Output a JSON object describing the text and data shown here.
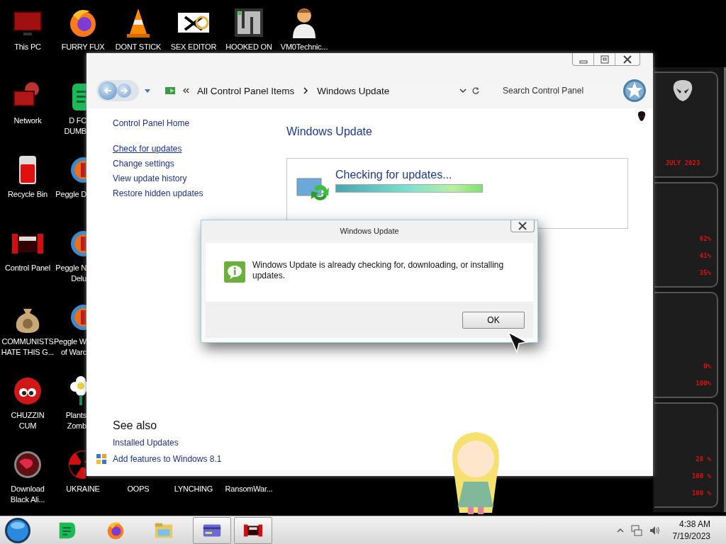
{
  "desktop": {
    "rows": [
      [
        {
          "label": [
            "This PC"
          ]
        },
        {
          "label": [
            "FURRY FUX"
          ]
        },
        {
          "label": [
            "DONT STICK"
          ]
        },
        {
          "label": [
            "SEX EDITOR"
          ]
        },
        {
          "label": [
            "HOOKED ON"
          ]
        },
        {
          "label": [
            "VM0Technic..."
          ]
        }
      ],
      [
        {
          "label": [
            "Network"
          ]
        },
        {
          "label": [
            "D FC",
            "DUMB"
          ]
        }
      ],
      [
        {
          "label": [
            "Recycle Bin"
          ]
        },
        {
          "label": [
            "Peggle D"
          ]
        }
      ],
      [
        {
          "label": [
            "Control Panel"
          ]
        },
        {
          "label": [
            "Peggle N",
            "Delu"
          ]
        }
      ],
      [
        {
          "label": [
            "COMMUNISTS",
            "HATE THIS G..."
          ]
        },
        {
          "label": [
            "Peggle W",
            "of Warc"
          ]
        }
      ],
      [
        {
          "label": [
            "CHUZZIN",
            "CUM"
          ]
        },
        {
          "label": [
            "Plants",
            "Zomb"
          ]
        }
      ],
      [
        {
          "label": [
            "Download",
            "Black Ali..."
          ]
        },
        {
          "label": [
            "UKRAINE"
          ]
        },
        {
          "label": [
            "OOPS"
          ]
        },
        {
          "label": [
            "LYNCHING"
          ]
        },
        {
          "label": [
            "RansomWar..."
          ]
        }
      ]
    ]
  },
  "gadget": {
    "date": "JULY 2023",
    "panels": [
      [
        "62%",
        "41%",
        "35%"
      ],
      [
        "0%",
        "100%"
      ],
      [
        "28 %",
        "100 %",
        "100 %"
      ]
    ]
  },
  "window": {
    "breadcrumb": [
      "All Control Panel Items",
      "Windows Update"
    ],
    "search": {
      "placeholder": "Search Control Panel"
    },
    "sidebar": {
      "home": "Control Panel Home",
      "links": [
        {
          "label": "Check for updates",
          "hovered": true
        },
        {
          "label": "Change settings",
          "hovered": false
        },
        {
          "label": "View update history",
          "hovered": false
        },
        {
          "label": "Restore hidden updates",
          "hovered": false
        }
      ],
      "see_also_title": "See also",
      "see_also": [
        {
          "label": "Installed Updates",
          "kind": "plain"
        },
        {
          "label": "Add features to Windows 8.1",
          "kind": "icon"
        }
      ]
    },
    "heading": "Windows Update",
    "status": "Checking for updates...",
    "progress": {
      "level": 1
    }
  },
  "dialog": {
    "title": "Windows Update",
    "message": "Windows Update is already checking for, downloading, or installing updates.",
    "button": "OK"
  },
  "taskbar": {
    "apps": [
      {
        "active": false
      },
      {
        "active": false
      },
      {
        "active": false
      },
      {
        "active": true
      },
      {
        "active": true
      }
    ],
    "time": "4:38 AM",
    "date": "7/19/2023"
  }
}
